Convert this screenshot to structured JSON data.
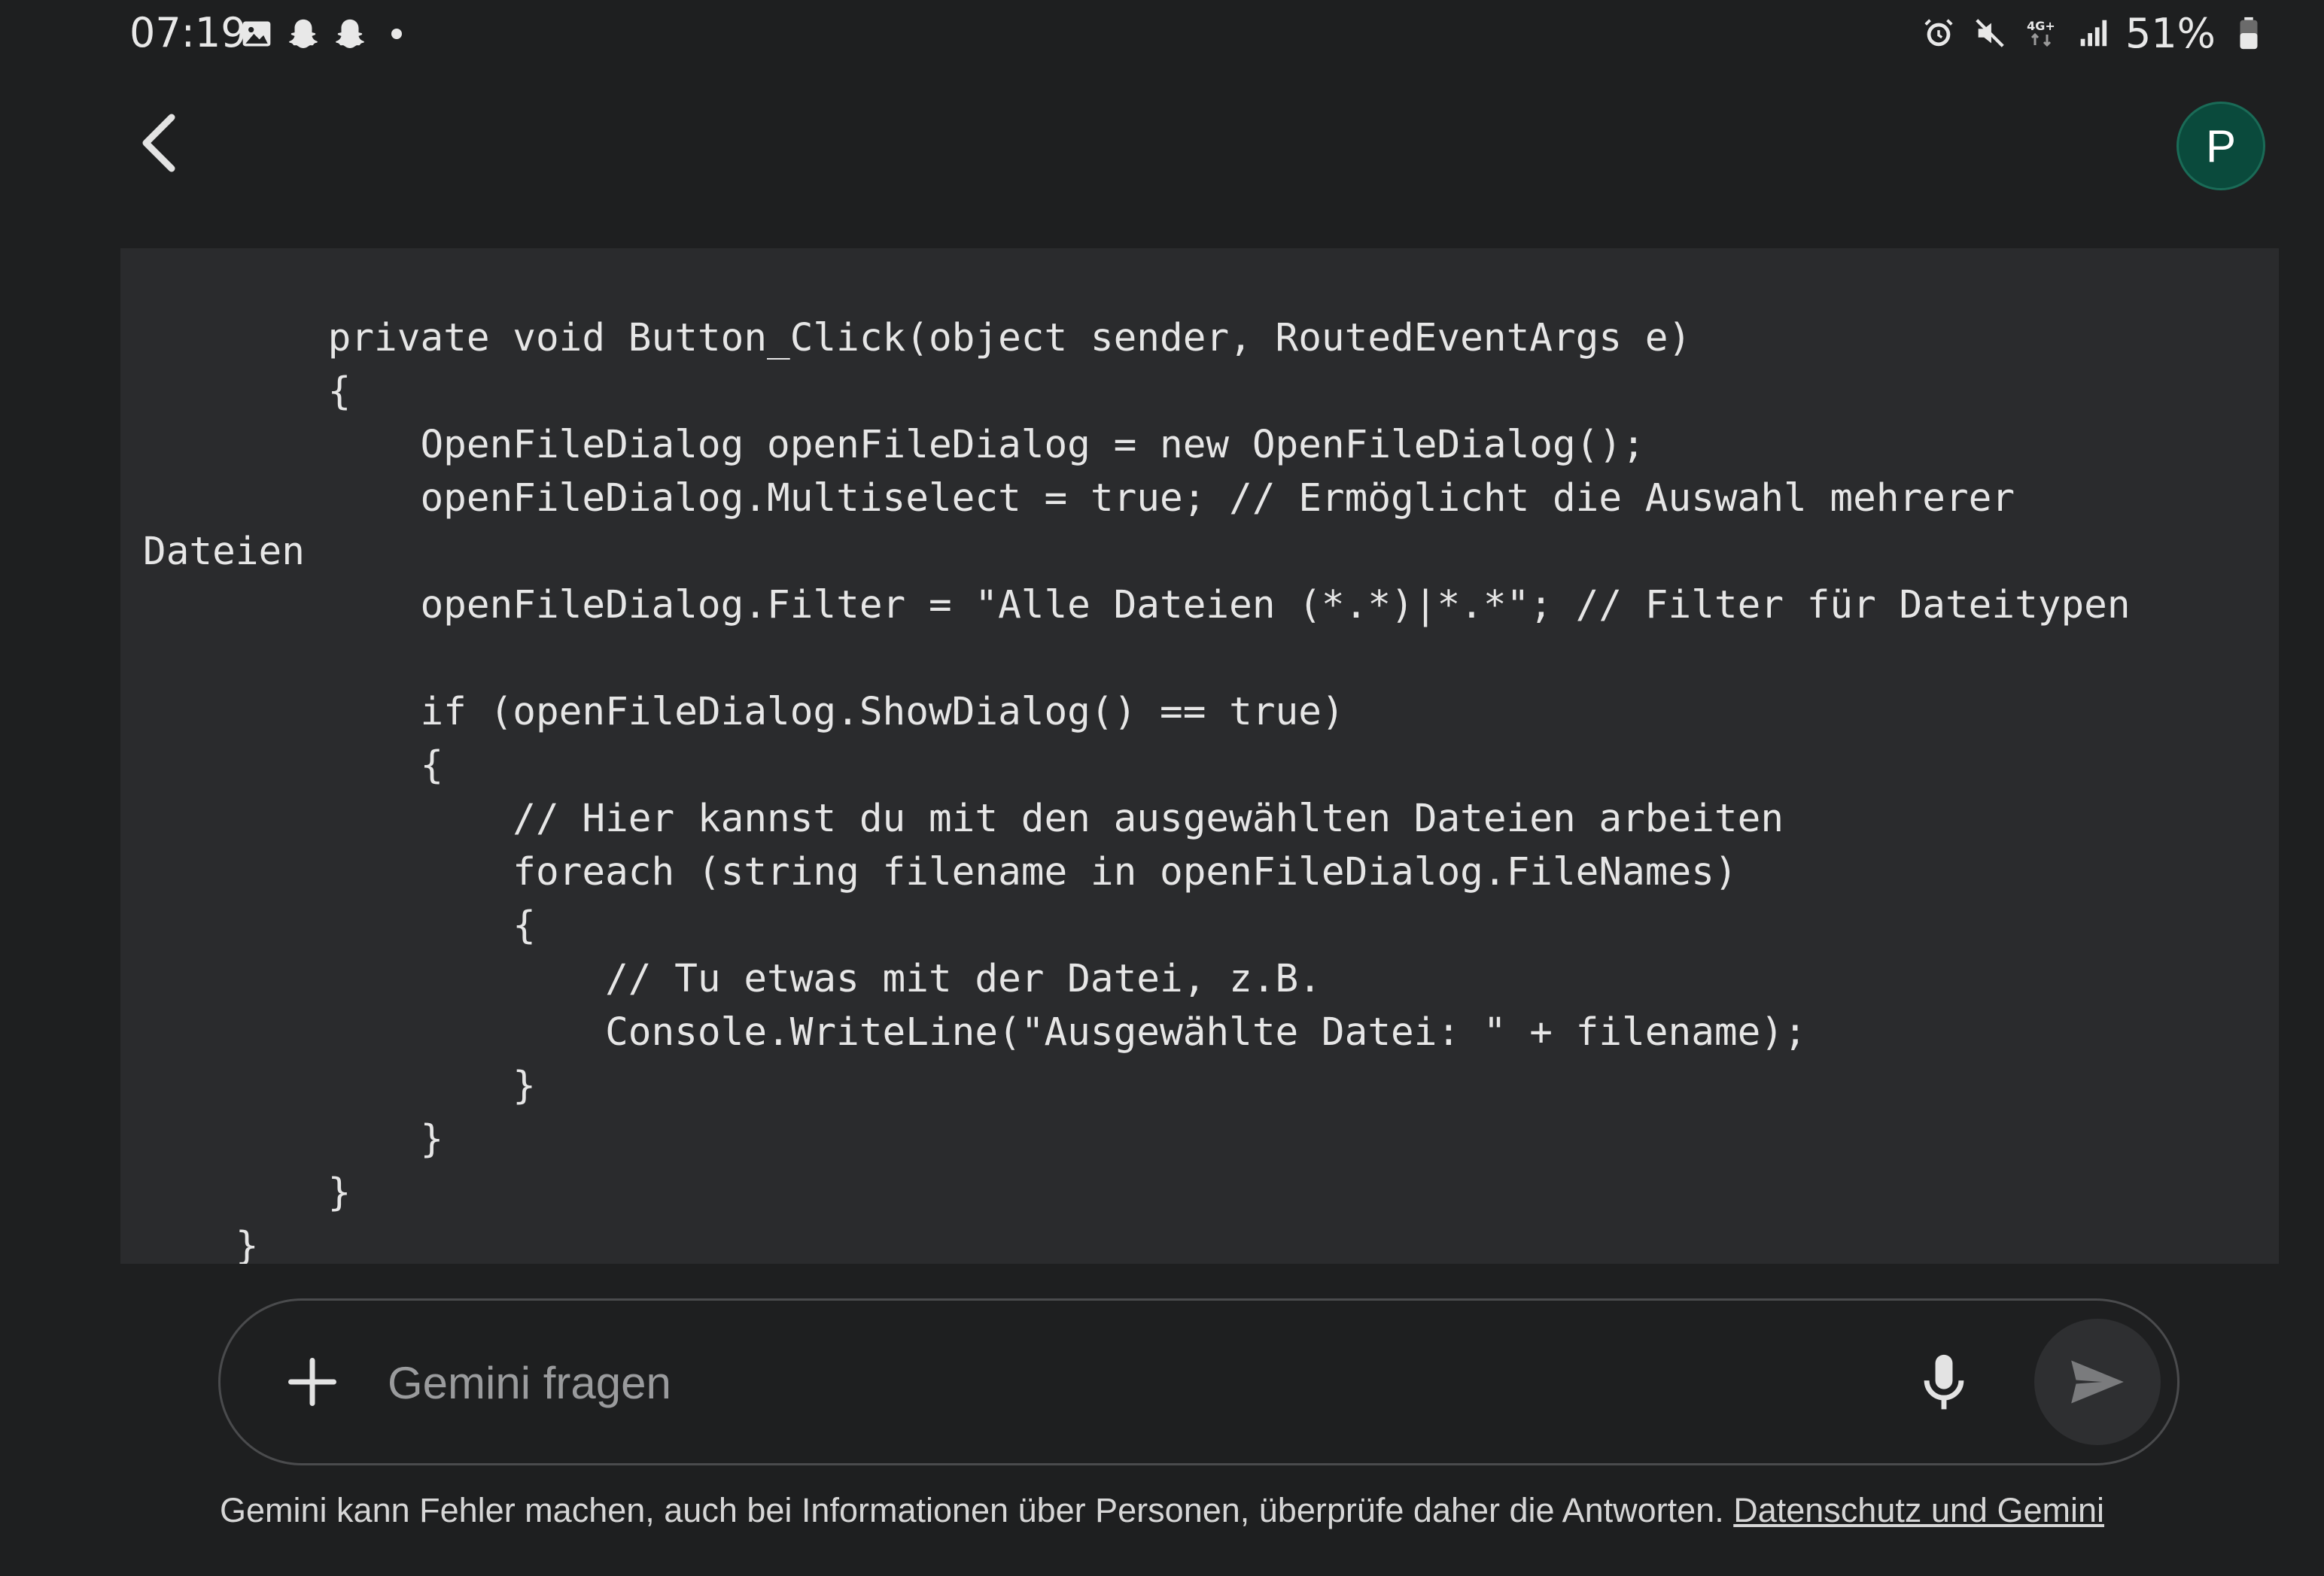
{
  "status_bar": {
    "time": "07:19",
    "left_icons": [
      "gallery-icon",
      "snapchat-icon",
      "snapchat-icon",
      "notification-dot-icon"
    ],
    "right_icons": [
      "alarm-icon",
      "mute-icon",
      "network-4g-plus-icon",
      "signal-icon"
    ],
    "network_label": "4G+",
    "battery_percent": "51%"
  },
  "header": {
    "back_icon": "chevron-left-icon",
    "avatar_letter": "P",
    "avatar_color": "#0a4a3c"
  },
  "code": {
    "lines": [
      "        private void Button_Click(object sender, RoutedEventArgs e)",
      "        {",
      "            OpenFileDialog openFileDialog = new OpenFileDialog();",
      "            openFileDialog.Multiselect = true; // Ermöglicht die Auswahl mehrerer",
      "Dateien",
      "            openFileDialog.Filter = \"Alle Dateien (*.*)|*.*\"; // Filter für Dateitypen",
      "",
      "            if (openFileDialog.ShowDialog() == true)",
      "            {",
      "                // Hier kannst du mit den ausgewählten Dateien arbeiten",
      "                foreach (string filename in openFileDialog.FileNames)",
      "                {",
      "                    // Tu etwas mit der Datei, z.B.",
      "                    Console.WriteLine(\"Ausgewählte Datei: \" + filename);",
      "                }",
      "            }",
      "        }",
      "    }"
    ]
  },
  "input": {
    "placeholder": "Gemini fragen",
    "value": "",
    "add_icon": "plus-icon",
    "mic_icon": "microphone-icon",
    "send_icon": "send-icon"
  },
  "footer": {
    "disclaimer_text": "Gemini kann Fehler machen, auch bei Informationen über Personen, überprüfe daher die Antworten.",
    "privacy_link": "Datenschutz und Gemini"
  },
  "colors": {
    "background": "#1e1f20",
    "code_background": "#2a2b2d",
    "text": "#e3e3e3"
  }
}
